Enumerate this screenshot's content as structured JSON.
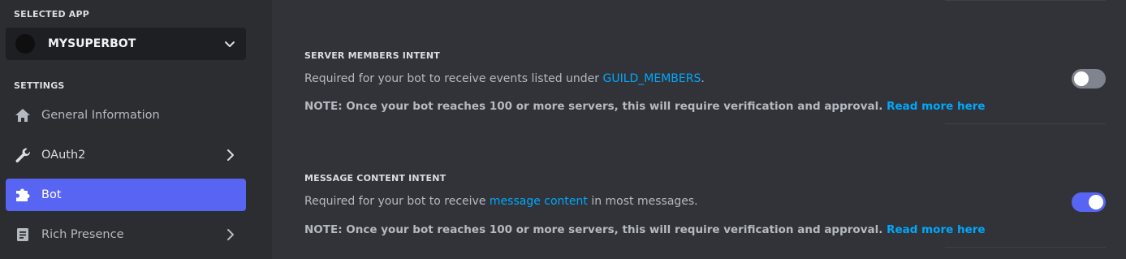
{
  "sidebar": {
    "selected_app_label": "SELECTED APP",
    "app_name": "MYSUPERBOT",
    "settings_label": "SETTINGS",
    "items": [
      {
        "label": "General Information",
        "icon": "home-icon",
        "has_arrow": false,
        "active": false
      },
      {
        "label": "OAuth2",
        "icon": "wrench-icon",
        "has_arrow": true,
        "active": false
      },
      {
        "label": "Bot",
        "icon": "puzzle-icon",
        "has_arrow": false,
        "active": true
      },
      {
        "label": "Rich Presence",
        "icon": "document-icon",
        "has_arrow": true,
        "active": false
      }
    ]
  },
  "intents": [
    {
      "title": "SERVER MEMBERS INTENT",
      "desc_before": "Required for your bot to receive events listed under ",
      "desc_link": "GUILD_MEMBERS",
      "desc_after": ".",
      "note": "NOTE: Once your bot reaches 100 or more servers, this will require verification and approval.",
      "note_link": "Read more here",
      "enabled": false
    },
    {
      "title": "MESSAGE CONTENT INTENT",
      "desc_before": "Required for your bot to receive ",
      "desc_link": "message content",
      "desc_after": " in most messages.",
      "note": "NOTE: Once your bot reaches 100 or more servers, this will require verification and approval.",
      "note_link": "Read more here",
      "enabled": true
    }
  ],
  "colors": {
    "accent": "#5865f2",
    "link": "#00a8fc",
    "toggle_off": "#80848e",
    "sidebar_bg": "#2b2d31",
    "main_bg": "#313338"
  }
}
